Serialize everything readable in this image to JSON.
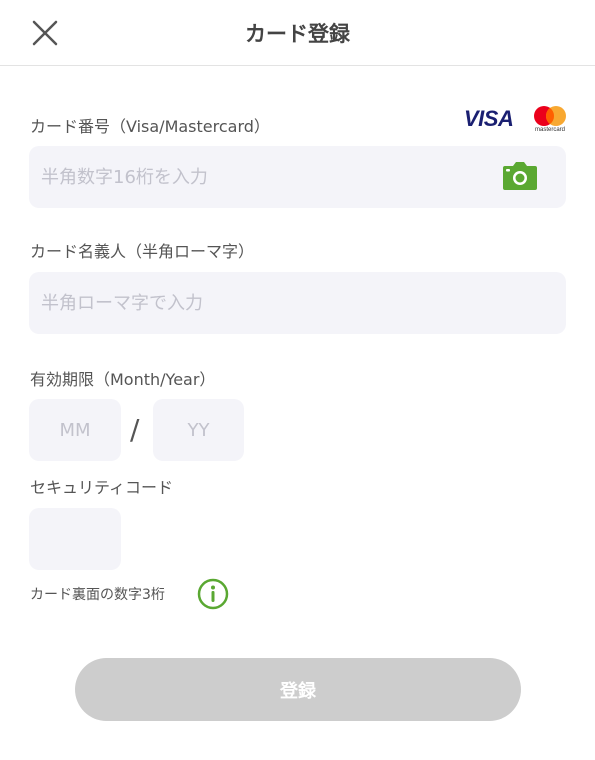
{
  "header": {
    "title": "カード登録"
  },
  "card_number": {
    "label": "カード番号（Visa/Mastercard）",
    "placeholder": "半角数字16桁を入力",
    "value": "",
    "brands": {
      "visa": "VISA",
      "mastercard": "mastercard"
    }
  },
  "card_holder": {
    "label": "カード名義人（半角ローマ字）",
    "placeholder": "半角ローマ字で入力",
    "value": ""
  },
  "expiry": {
    "label": "有効期限（Month/Year）",
    "month_placeholder": "MM",
    "year_placeholder": "YY",
    "separator": "/"
  },
  "security_code": {
    "label": "セキュリティコード",
    "value": "",
    "help": "カード裏面の数字3桁"
  },
  "submit": {
    "label": "登録"
  },
  "colors": {
    "accent_green": "#5aa832",
    "field_bg": "#f4f4f9",
    "button_disabled": "#cdcdcd",
    "visa_blue": "#1a1f71",
    "mc_red": "#eb001b",
    "mc_orange": "#f79e1b"
  }
}
